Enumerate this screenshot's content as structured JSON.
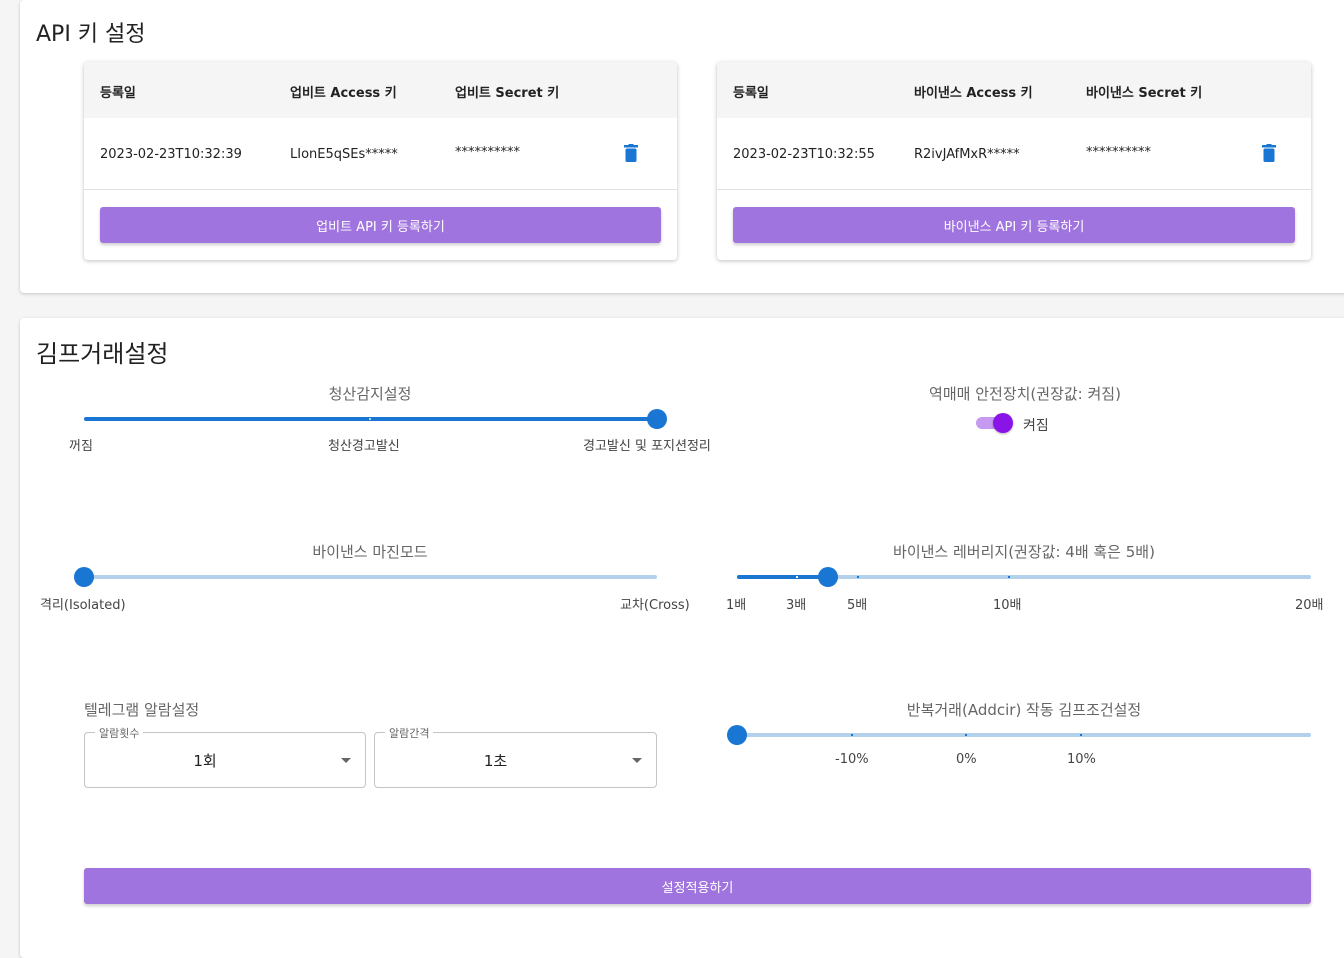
{
  "api_section": {
    "title": "API 키 설정",
    "upbit": {
      "headers": [
        "등록일",
        "업비트 Access 키",
        "업비트 Secret 키"
      ],
      "row": {
        "date": "2023-02-23T10:32:39",
        "access": "LIonE5qSEs*****",
        "secret": "**********",
        "delete_icon": "trash-icon"
      },
      "register_button": "업비트 API 키 등록하기"
    },
    "binance": {
      "headers": [
        "등록일",
        "바이낸스 Access 키",
        "바이낸스 Secret 키"
      ],
      "row": {
        "date": "2023-02-23T10:32:55",
        "access": "R2ivJAfMxR*****",
        "secret": "**********",
        "delete_icon": "trash-icon"
      },
      "register_button": "바이낸스 API 키 등록하기"
    }
  },
  "kimp_section": {
    "title": "김프거래설정",
    "liquidation": {
      "label": "청산감지설정",
      "marks": [
        "꺼짐",
        "청산경고발신",
        "경고발신 및 포지션정리"
      ],
      "selected_index": 2
    },
    "reverse_safety": {
      "label": "역매매 안전장치(권장값: 켜짐)",
      "toggle_label": "켜짐",
      "on": true
    },
    "margin_mode": {
      "label": "바이낸스 마진모드",
      "marks": [
        "격리(Isolated)",
        "교차(Cross)"
      ],
      "selected_index": 0
    },
    "leverage": {
      "label": "바이낸스 레버리지(권장값: 4배 혹은 5배)",
      "marks": [
        "1배",
        "3배",
        "5배",
        "10배",
        "20배"
      ],
      "value": 4
    },
    "telegram": {
      "label": "텔레그램 알람설정",
      "count": {
        "legend": "알람횟수",
        "value": "1회"
      },
      "interval": {
        "legend": "알람간격",
        "value": "1초"
      }
    },
    "addcir": {
      "label": "반복거래(Addcir) 작동 김프조건설정",
      "marks": [
        "-10%",
        "0%",
        "10%"
      ],
      "value": "min"
    },
    "apply_button": "설정적용하기"
  },
  "colors": {
    "accent": "#a074de",
    "slider": "#1976d2",
    "toggle": "#8a2be2"
  }
}
